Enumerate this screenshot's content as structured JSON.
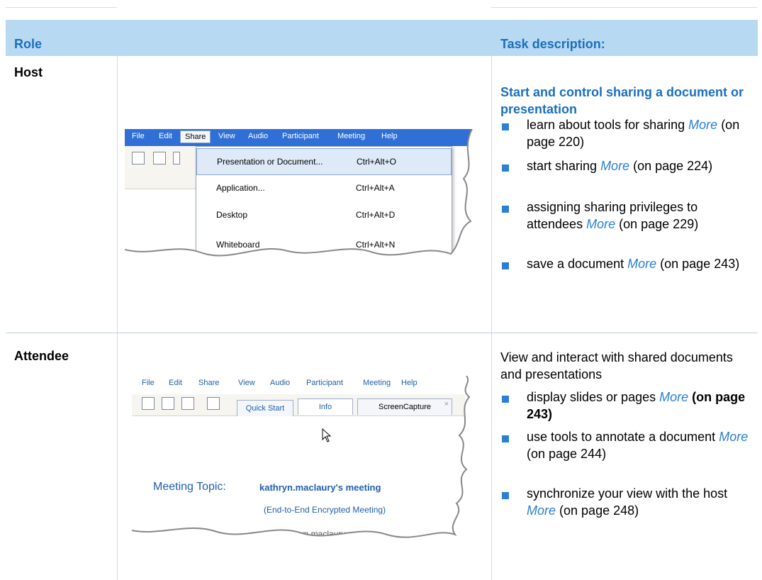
{
  "header": {
    "role_label": "Role",
    "task_label": "Task description:"
  },
  "rows": [
    {
      "role": "Host",
      "title": "Start and control sharing a document or presentation",
      "items": [
        {
          "text": "learn about tools for sharing",
          "more": "More",
          "suffix": "(on page 220)"
        },
        {
          "text": "start sharing",
          "more": "More",
          "suffix": "(on page 224)"
        },
        {
          "text": "assigning sharing privileges to attendees",
          "more": "More",
          "suffix": "(on page 229)"
        },
        {
          "text": "save a document",
          "more": "More",
          "suffix": "(on page 243)"
        }
      ],
      "screenshot": {
        "menu": [
          "File",
          "Edit",
          "Share",
          "View",
          "Audio",
          "Participant",
          "Meeting",
          "Help"
        ],
        "dropdown": [
          {
            "label": "Presentation or Document...",
            "shortcut": "Ctrl+Alt+O"
          },
          {
            "label": "Application...",
            "shortcut": "Ctrl+Alt+A"
          },
          {
            "label": "Desktop",
            "shortcut": "Ctrl+Alt+D"
          },
          {
            "label": "Whiteboard",
            "shortcut": "Ctrl+Alt+N"
          }
        ]
      }
    },
    {
      "role": "Attendee",
      "title": "View and interact with shared documents and presentations",
      "items": [
        {
          "text": "display slides or pages",
          "more": "More",
          "suffix": "(on page 243)"
        },
        {
          "text": "use tools to annotate a document",
          "more": "More",
          "suffix": "(on page 244)"
        },
        {
          "text": "synchronize your view with the host",
          "more": "More",
          "suffix": "(on page 248)"
        }
      ],
      "screenshot": {
        "menu": [
          "File",
          "Edit",
          "Share",
          "View",
          "Audio",
          "Participant",
          "Meeting",
          "Help"
        ],
        "tabs": [
          "Quick Start",
          "Info",
          "ScreenCapture"
        ],
        "tab_close": "×",
        "topic_label": "Meeting Topic:",
        "topic_value": "kathryn.maclaury's meeting",
        "encryption": "(End-to-End Encrypted Meeting)",
        "partial_text": "kathryn.maclaury"
      }
    }
  ],
  "colors": {
    "header_bg": "#b8d9f2",
    "accent": "#1a6fbf",
    "link": "#2b7fd4"
  }
}
